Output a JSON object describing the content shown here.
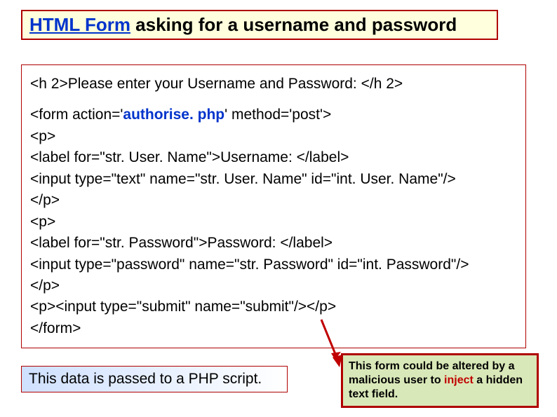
{
  "title": {
    "link_text": "HTML Form",
    "rest": " asking for a username and password"
  },
  "code": {
    "line1": "<h 2>Please enter your Username and Password: </h 2>",
    "line2_pre": "<form action='",
    "line2_hl": "authorise. php",
    "line2_post": "' method='post'>",
    "line3": "<p>",
    "line4": "<label for=\"str. User. Name\">Username: </label>",
    "line5": "<input type=\"text\" name=\"str. User. Name\" id=\"int. User. Name\"/>",
    "line6": "</p>",
    "line7": "<p>",
    "line8": "<label for=\"str. Password\">Password: </label>",
    "line9": "<input type=\"password\" name=\"str. Password\" id=\"int. Password\"/>",
    "line10": "</p>",
    "line11": "<p><input type=\"submit\" name=\"submit\"/></p>",
    "line12": "</form>"
  },
  "caption": "This data is passed to a PHP script.",
  "warn": {
    "pre": "This form could be altered by a malicious user to ",
    "inject": "inject",
    "post": " a hidden text field."
  }
}
